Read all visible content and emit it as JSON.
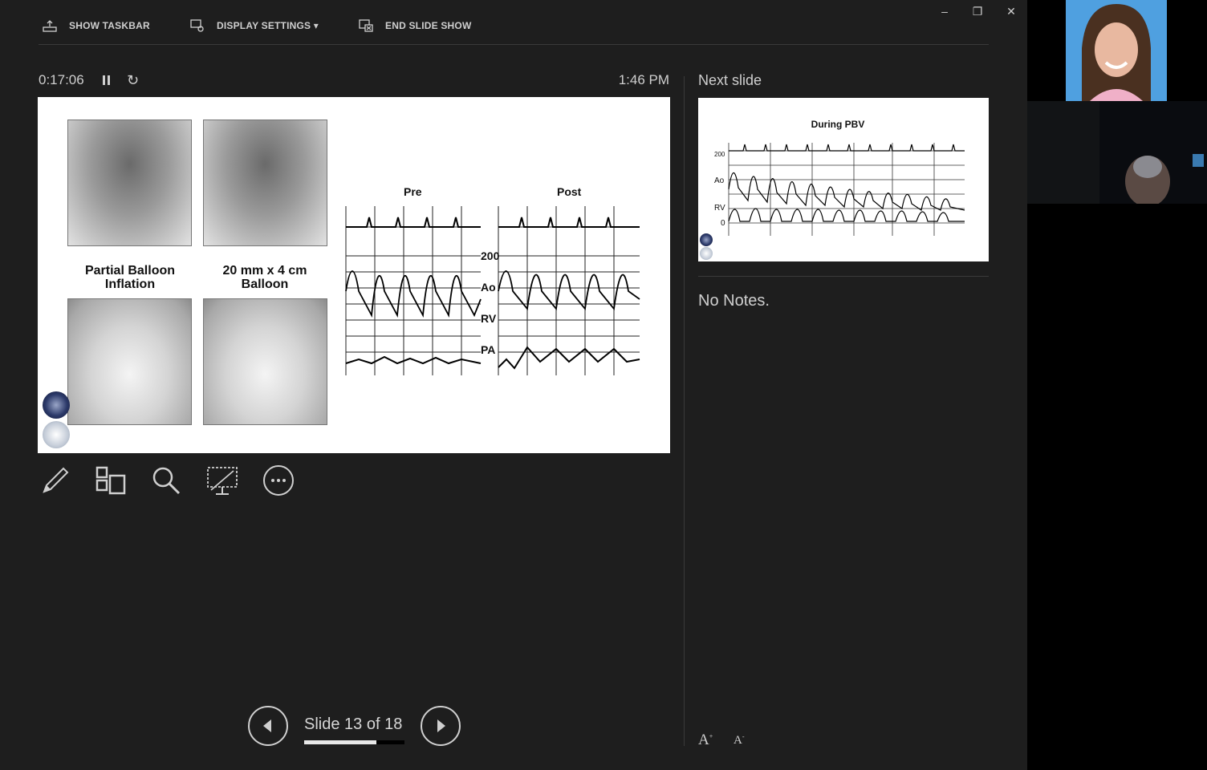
{
  "toolbar": {
    "show_taskbar": "SHOW TASKBAR",
    "display_settings": "DISPLAY SETTINGS ▾",
    "end_slide_show": "END SLIDE SHOW"
  },
  "window": {
    "minimize": "–",
    "restore": "❐",
    "close": "✕"
  },
  "timer": {
    "elapsed": "0:17:06",
    "restart_glyph": "↻",
    "clock": "1:46 PM"
  },
  "slide": {
    "caption_left": "Partial Balloon Inflation",
    "caption_right": "20 mm x 4 cm Balloon",
    "waveform_pre": "Pre",
    "waveform_post": "Post",
    "labels": {
      "scale": "200",
      "ao": "Ao",
      "rv": "RV",
      "pa": "PA"
    }
  },
  "tools": [
    "pen-tool",
    "see-all-slides",
    "zoom",
    "black-screen",
    "more-options"
  ],
  "navigation": {
    "slide_label": "Slide 13 of 18",
    "current": 13,
    "total": 18
  },
  "next_slide": {
    "label": "Next slide",
    "title": "During PBV",
    "labels": {
      "scale": "200",
      "ao": "Ao",
      "rv": "RV",
      "zero": "0"
    }
  },
  "notes": {
    "text": "No Notes."
  },
  "font_controls": {
    "increase": "A",
    "decrease": "A"
  },
  "colors": {
    "background": "#1e1e1e",
    "text": "#d6d6d6",
    "accent": "#ffffff"
  }
}
